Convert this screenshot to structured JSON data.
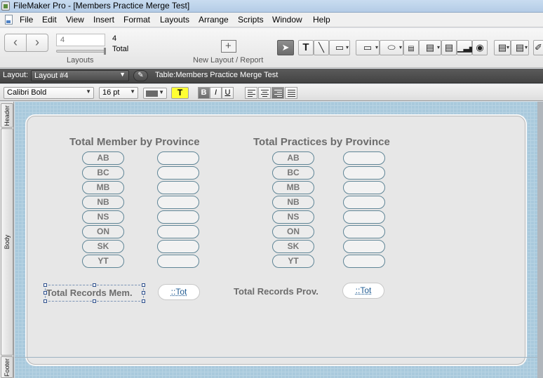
{
  "window": {
    "title": "FileMaker Pro - [Members Practice Merge Test]"
  },
  "menu": [
    "File",
    "Edit",
    "View",
    "Insert",
    "Format",
    "Layouts",
    "Arrange",
    "Scripts",
    "Window",
    "Help"
  ],
  "toolbar": {
    "record_value": "4",
    "record_count": "4",
    "total_label": "Total",
    "layouts_caption": "Layouts",
    "new_layout_caption": "New Layout / Report"
  },
  "layout_bar": {
    "label": "Layout:",
    "layout_name": "Layout #4",
    "table_label": "Table:Members Practice Merge Test"
  },
  "format_bar": {
    "font": "Calibri Bold",
    "size": "16 pt",
    "highlight_label": "T",
    "bold": "B",
    "italic": "I",
    "underline": "U",
    "text_color": "#6a6a6a"
  },
  "parts": {
    "header": "Header",
    "body": "Body",
    "footer": "Footer"
  },
  "layout": {
    "members_title": "Total Member by Province",
    "practices_title": "Total Practices by Province",
    "provinces": [
      "AB",
      "BC",
      "MB",
      "NB",
      "NS",
      "ON",
      "SK",
      "YT"
    ],
    "total_members_label": "Total Records Mem.",
    "total_members_field": "::Tot",
    "total_practices_label": "Total Records Prov.",
    "total_practices_field": "::Tot"
  },
  "colors": {
    "canvas": "#a9c9dc",
    "field_border": "#5f8596",
    "label_text": "#6c6c6c"
  }
}
